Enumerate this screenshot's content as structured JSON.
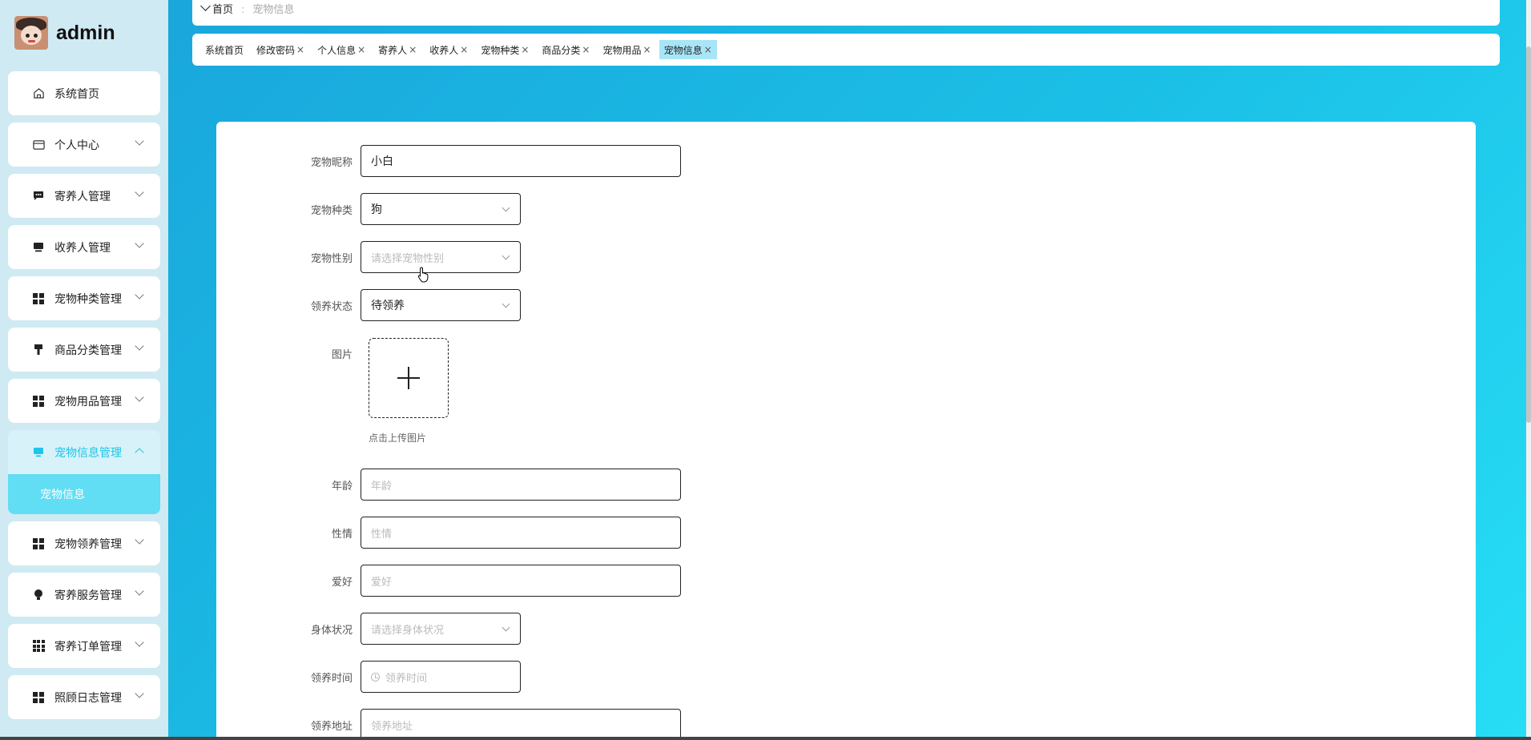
{
  "sidebar": {
    "username": "admin",
    "items": [
      {
        "label": "系统首页",
        "icon": "home-icon"
      },
      {
        "label": "个人中心",
        "icon": "wallet-icon"
      },
      {
        "label": "寄养人管理",
        "icon": "chat-icon"
      },
      {
        "label": "收养人管理",
        "icon": "monitor-icon"
      },
      {
        "label": "宠物种类管理",
        "icon": "grid-icon"
      },
      {
        "label": "商品分类管理",
        "icon": "brush-icon"
      },
      {
        "label": "宠物用品管理",
        "icon": "grid-icon"
      },
      {
        "label": "宠物信息管理",
        "icon": "screen-icon"
      },
      {
        "label": "宠物领养管理",
        "icon": "grid-icon"
      },
      {
        "label": "寄养服务管理",
        "icon": "bulb-icon"
      },
      {
        "label": "寄养订单管理",
        "icon": "grid9-icon"
      },
      {
        "label": "照顾日志管理",
        "icon": "grid-icon"
      }
    ],
    "submenu_active": "宠物信息"
  },
  "breadcrumb": {
    "home": "首页",
    "separator": ":",
    "current": "宠物信息"
  },
  "tabs": [
    {
      "label": "系统首页",
      "closable": false
    },
    {
      "label": "修改密码",
      "closable": true
    },
    {
      "label": "个人信息",
      "closable": true
    },
    {
      "label": "寄养人",
      "closable": true
    },
    {
      "label": "收养人",
      "closable": true
    },
    {
      "label": "宠物种类",
      "closable": true
    },
    {
      "label": "商品分类",
      "closable": true
    },
    {
      "label": "宠物用品",
      "closable": true
    },
    {
      "label": "宠物信息",
      "closable": true,
      "active": true
    }
  ],
  "close_glyph": "×",
  "form": {
    "nickname": {
      "label": "宠物昵称",
      "value": "小白"
    },
    "species": {
      "label": "宠物种类",
      "value": "狗"
    },
    "gender": {
      "label": "宠物性别",
      "placeholder": "请选择宠物性别"
    },
    "status": {
      "label": "领养状态",
      "value": "待领养"
    },
    "image": {
      "label": "图片",
      "hint": "点击上传图片"
    },
    "age": {
      "label": "年龄",
      "placeholder": "年龄"
    },
    "temper": {
      "label": "性情",
      "placeholder": "性情"
    },
    "hobby": {
      "label": "爱好",
      "placeholder": "爱好"
    },
    "health": {
      "label": "身体状况",
      "placeholder": "请选择身体状况"
    },
    "adopt_time": {
      "label": "领养时间",
      "placeholder": "领养时间"
    },
    "address": {
      "label": "领养地址",
      "placeholder": "领养地址"
    }
  },
  "colors": {
    "accent": "#1cc5ea",
    "submenu_bg": "#61ddf4",
    "sidebar_bg": "#cfeaf3",
    "active_tab": "#a8e6f7"
  }
}
